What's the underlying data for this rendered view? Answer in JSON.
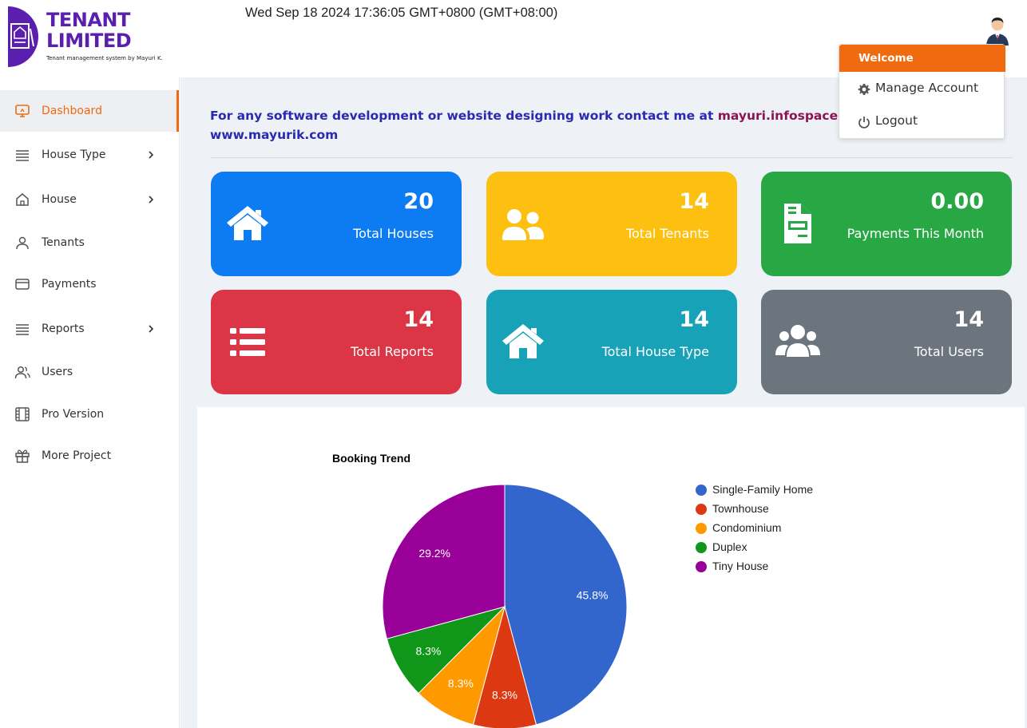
{
  "header": {
    "logo_title_line1": "TENANT",
    "logo_title_line2": "LIMITED",
    "logo_subtitle": "Tenant management system by Mayuri K.",
    "datetime": "Wed Sep 18 2024 17:36:05 GMT+0800 (GMT+08:00)"
  },
  "user_menu": {
    "heading": "Welcome",
    "manage_account": "Manage Account",
    "logout": "Logout"
  },
  "sidebar": {
    "items": [
      {
        "label": "Dashboard",
        "icon": "monitor-icon",
        "active": true
      },
      {
        "label": "House Type",
        "icon": "list-icon",
        "has_submenu": true
      },
      {
        "label": "House",
        "icon": "home-icon",
        "has_submenu": true
      },
      {
        "label": "Tenants",
        "icon": "user-icon"
      },
      {
        "label": "Payments",
        "icon": "credit-card-icon"
      },
      {
        "label": "Reports",
        "icon": "list-icon",
        "has_submenu": true
      },
      {
        "label": "Users",
        "icon": "users-icon"
      },
      {
        "label": "Pro Version",
        "icon": "film-icon"
      },
      {
        "label": "More Project",
        "icon": "gift-icon"
      }
    ]
  },
  "notice": {
    "part1": "For any software development or website designing work contact me at ",
    "email": "mayuri.infospace@gmail.com",
    "website": "www.mayurik.com"
  },
  "stats": [
    {
      "value": "20",
      "label": "Total Houses",
      "color": "#0d7cf2",
      "icon": "home-icon"
    },
    {
      "value": "14",
      "label": "Total Tenants",
      "color": "#fdc010",
      "icon": "users-icon"
    },
    {
      "value": "0.00",
      "label": "Payments This Month",
      "color": "#28a745",
      "icon": "invoice-icon"
    },
    {
      "value": "14",
      "label": "Total Reports",
      "color": "#dc3545",
      "icon": "list-icon"
    },
    {
      "value": "14",
      "label": "Total House Type",
      "color": "#17a2b8",
      "icon": "home-icon"
    },
    {
      "value": "14",
      "label": "Total Users",
      "color": "#6c757d",
      "icon": "users-group-icon"
    }
  ],
  "chart_data": {
    "type": "pie",
    "title": "Booking Trend",
    "legend_position": "right",
    "categories": [
      "Single-Family Home",
      "Townhouse",
      "Condominium",
      "Duplex",
      "Tiny House"
    ],
    "values": [
      45.8,
      8.3,
      8.3,
      8.3,
      29.2
    ],
    "value_labels": [
      "45.8%",
      "8.3%",
      "8.3%",
      "8.3%",
      "29.2%"
    ],
    "colors": [
      "#3366cc",
      "#dc3912",
      "#ff9900",
      "#109618",
      "#990099"
    ]
  }
}
